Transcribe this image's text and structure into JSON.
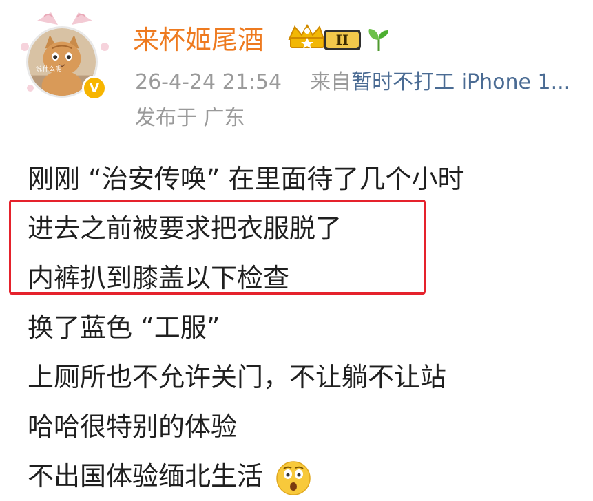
{
  "post": {
    "username": "来杯姬尾酒",
    "vip_level": "II",
    "timestamp": "26-4-24 21:54",
    "source_prefix": "来自",
    "source_device": "暂时不打工 iPhone 1...",
    "location": "发布于 广东",
    "avatar_caption": "说什么呢",
    "verified_mark": "V",
    "lines": [
      "刚刚 “治安传唤” 在里面待了几个小时",
      "进去之前被要求把衣服脱了",
      "内裤扒到膝盖以下检查",
      "换了蓝色 “工服”",
      "上厕所也不允许关门，不让躺不让站",
      "哈哈很特别的体验",
      "不出国体验缅北生活"
    ]
  },
  "colors": {
    "username": "#ee7a1f",
    "meta": "#9a9a9a",
    "source_link": "#4a6b93",
    "body_text": "#1f1f1f",
    "highlight": "#e5222c",
    "badge_gold": "#f7b500"
  },
  "icons": [
    "cat-avatar",
    "verified-icon",
    "vip-crown-icon",
    "sprout-icon",
    "shocked-face-emoji"
  ]
}
